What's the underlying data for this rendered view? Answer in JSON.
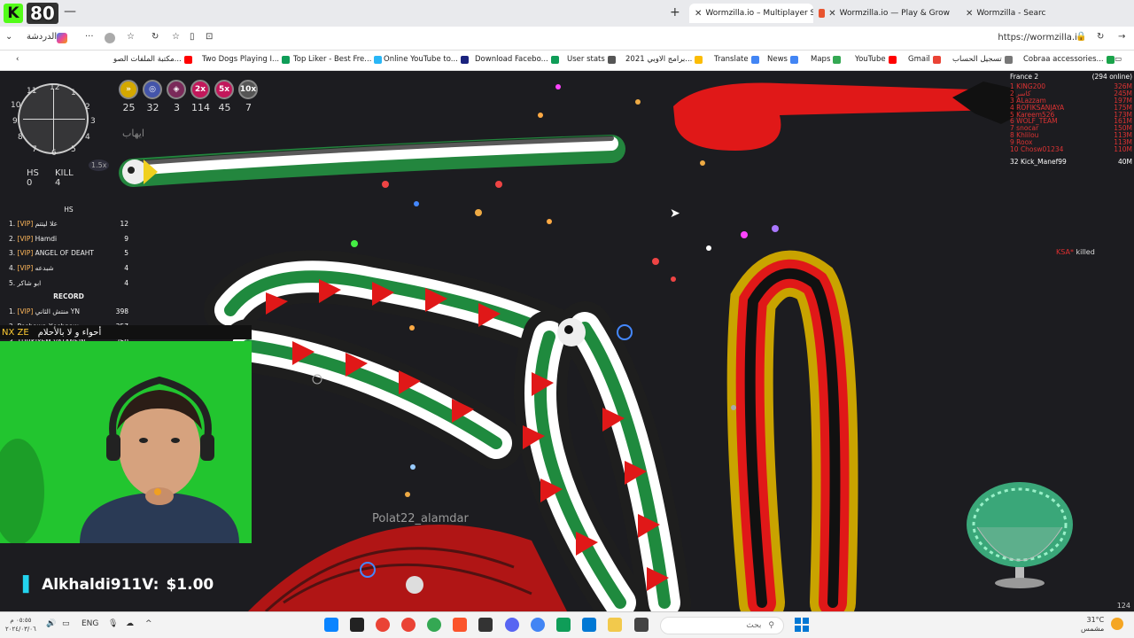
{
  "browser": {
    "kick_viewers": "80",
    "tabs": [
      {
        "title": "Wormzilla.io – Multiplayer Snake Game",
        "active": true
      },
      {
        "title": "Wormzilla.io — Play & Grow",
        "active": false
      },
      {
        "title": "Wormzilla - Search",
        "active": false
      }
    ],
    "chat_label": "الدردشة",
    "url": "https://wormzilla.io",
    "bookmarks": [
      {
        "label": "Cobraa accessories...",
        "color": "#1aa34a"
      },
      {
        "label": "تسجيل الحساب",
        "color": "#777"
      },
      {
        "label": "Gmail",
        "color": "#ea4335"
      },
      {
        "label": "YouTube",
        "color": "#ff0000"
      },
      {
        "label": "Maps",
        "color": "#34a853"
      },
      {
        "label": "News",
        "color": "#4285f4"
      },
      {
        "label": "Translate",
        "color": "#4285f4"
      },
      {
        "label": "برامج الاوبي 2021...",
        "color": "#fbbc04"
      },
      {
        "label": "User stats",
        "color": "#555"
      },
      {
        "label": "Download Facebo...",
        "color": "#0f9d58"
      },
      {
        "label": "Online YouTube to...",
        "color": "#1a237e"
      },
      {
        "label": "Top Liker - Best Fre...",
        "color": "#29b6f6"
      },
      {
        "label": "Two Dogs Playing I...",
        "color": "#0f9d58"
      },
      {
        "label": "مكتبة الملفات الصو...",
        "color": "#ff0000"
      }
    ]
  },
  "game": {
    "radar_labels": {
      "n": "12",
      "e": "3",
      "s": "6",
      "w": "9",
      "nne": "1",
      "ene": "2",
      "ese": "4",
      "sse": "5",
      "ssw": "7",
      "wsw": "8",
      "wnw": "10",
      "nnw": "11"
    },
    "zoom": "1.5x",
    "hs_label": "HS",
    "kill_label": "KILL",
    "hs_value": "0",
    "kill_value": "4",
    "powerups": [
      {
        "symbol": "»",
        "count": "25",
        "color": "#d4a800"
      },
      {
        "symbol": "◎",
        "count": "32",
        "color": "#4455aa"
      },
      {
        "symbol": "◈",
        "count": "3",
        "color": "#7a2a5a"
      },
      {
        "symbol": "2x",
        "count": "114",
        "color": "#c2185b"
      },
      {
        "symbol": "5x",
        "count": "45",
        "color": "#c2185b"
      },
      {
        "symbol": "10x",
        "count": "7",
        "color": "#555"
      }
    ],
    "player_label": "ايهاب",
    "left_leaderboard": {
      "hs_header": "HS",
      "rows": [
        {
          "rank": "1.",
          "vip": "[VIP]",
          "name": "علا ليتتم",
          "value": "12"
        },
        {
          "rank": "2.",
          "vip": "[VIP]",
          "name": "Hamdi",
          "value": "9"
        },
        {
          "rank": "3.",
          "vip": "[VIP]",
          "name": "ANGEL OF DEAHT",
          "value": "5"
        },
        {
          "rank": "4.",
          "vip": "[VIP]",
          "name": "شبدعه",
          "value": "4"
        },
        {
          "rank": "5.",
          "vip": "",
          "name": "ابو شاكر",
          "value": "4"
        }
      ],
      "record_header": "RECORD",
      "record_rows": [
        {
          "rank": "1.",
          "vip": "[VIP]",
          "name": "منتش الثاني YN",
          "value": "398"
        },
        {
          "rank": "2.",
          "vip": "",
          "name": "Peshawa Xoshnaw",
          "value": "357"
        },
        {
          "rank": "3.",
          "vip": "",
          "name": "TÜRKİYEM VATANSIN",
          "value": "250"
        }
      ]
    },
    "right_leaderboard": {
      "server": "France 2",
      "online": "(294 online)",
      "rows": [
        {
          "rank": "1",
          "name": "KING200",
          "score": "326M"
        },
        {
          "rank": "2",
          "name": "كاسر",
          "score": "245M"
        },
        {
          "rank": "3",
          "name": "ALazzam",
          "score": "197M"
        },
        {
          "rank": "4",
          "name": "ROFIKSANJAYA",
          "score": "175M"
        },
        {
          "rank": "5",
          "name": "Kareem526",
          "score": "173M"
        },
        {
          "rank": "6",
          "name": "WOLF_TEAM",
          "score": "161M"
        },
        {
          "rank": "7",
          "name": "snocar",
          "score": "150M"
        },
        {
          "rank": "8",
          "name": "Khlilou",
          "score": "113M"
        },
        {
          "rank": "9",
          "name": "Roox",
          "score": "113M"
        },
        {
          "rank": "10",
          "name": "Chosw01234",
          "score": "110M"
        }
      ],
      "me": {
        "rank": "32",
        "name": "Kick_Manef99",
        "score": "40M"
      }
    },
    "kill_message": {
      "killer": "KSA*",
      "verb": "killed"
    },
    "other_player": "Polat22_alamdar",
    "level": "124"
  },
  "stream": {
    "ticker_left": "NX ZE",
    "ticker_arabic": "أحواء و لا بالأحلام",
    "donor": "Alkhaldi911V:",
    "amount": "$1.00"
  },
  "taskbar": {
    "time": "٠٥:٥٥ م",
    "date": "٢٠٢٤/٠٣/٠٦",
    "lang": "ENG",
    "search": "بحث",
    "temp": "31°C",
    "weather": "مشمس"
  }
}
